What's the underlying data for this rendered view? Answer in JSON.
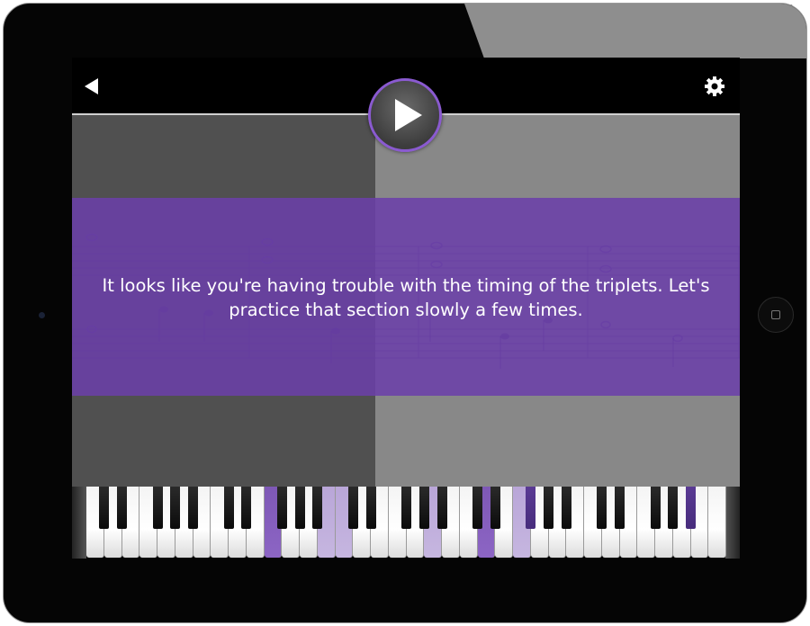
{
  "app": {
    "tip_message": "It looks like you're having trouble with the timing of the triplets. Let's practice that section slowly a few times."
  },
  "toolbar": {
    "back_icon": "back-arrow-icon",
    "play_icon": "play-icon",
    "settings_icon": "gear-icon"
  },
  "colors": {
    "accent_purple": "#6b3faa",
    "play_ring": "#8a5ad0",
    "left_pane": "#505050",
    "right_pane": "#888888",
    "key_highlight": "#8c65c4",
    "key_highlight_light": "#c6b6e0"
  },
  "keyboard": {
    "white_key_count": 36,
    "highlighted_white_keys": [
      10,
      22
    ],
    "light_highlighted_white_keys": [
      13,
      14,
      19,
      24
    ],
    "highlighted_black_keys": [
      17,
      24
    ]
  }
}
